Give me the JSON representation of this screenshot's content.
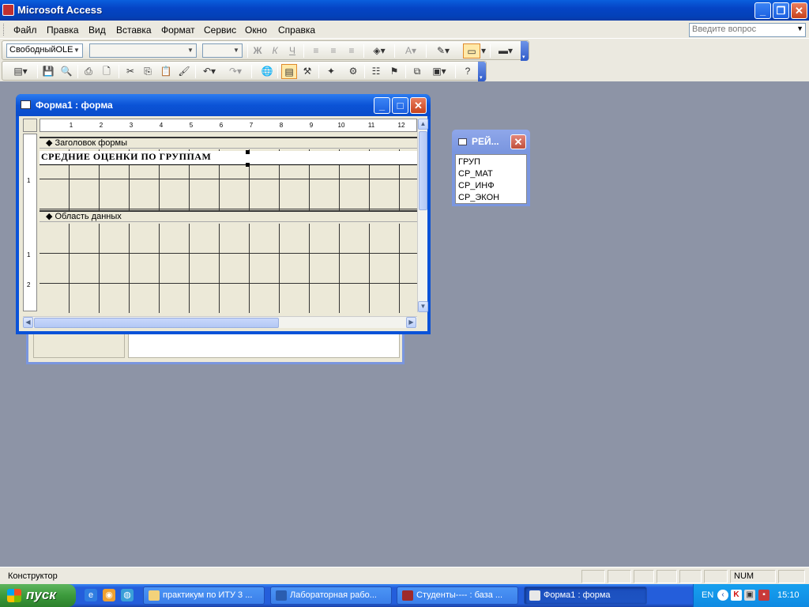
{
  "app": {
    "title": "Microsoft Access",
    "colors": {
      "titlebar": "#0a5fdd",
      "workspace": "#8d94a6",
      "taskbar": "#245edb",
      "start": "#3c9a3c"
    }
  },
  "menu": {
    "items": [
      "Файл",
      "Правка",
      "Вид",
      "Вставка",
      "Формат",
      "Сервис",
      "Окно",
      "Справка"
    ],
    "help_placeholder": "Введите вопрос"
  },
  "toolbar1": {
    "object_combo": "СвободныйOLE",
    "font_combo": "",
    "size_combo": "",
    "bold": "Ж",
    "italic": "К",
    "underline": "Ч",
    "font_color_letter": "A"
  },
  "form_window": {
    "title": "Форма1 : форма",
    "ruler_numbers": [
      "1",
      "2",
      "3",
      "4",
      "5",
      "6",
      "7",
      "8",
      "9",
      "10",
      "11",
      "12"
    ],
    "left_ruler_numbers": [
      "1",
      "1",
      "2"
    ],
    "header_section": "Заголовок формы",
    "detail_section": "Область данных",
    "label_text": "СРЕДНИЕ ОЦЕНКИ ПО ГРУППАМ"
  },
  "field_list": {
    "title": "РЕЙ...",
    "fields": [
      "ГРУП",
      "СР_МАТ",
      "СР_ИНФ",
      "СР_ЭКОН"
    ]
  },
  "statusbar": {
    "mode": "Конструктор",
    "num": "NUM"
  },
  "taskbar": {
    "start_label": "пуск",
    "tasks": [
      "практикум по ИТУ 3 ...",
      "Лабораторная рабо...",
      "Студенты---- : база ...",
      "Форма1 : форма"
    ],
    "lang": "EN",
    "clock": "15:10"
  }
}
